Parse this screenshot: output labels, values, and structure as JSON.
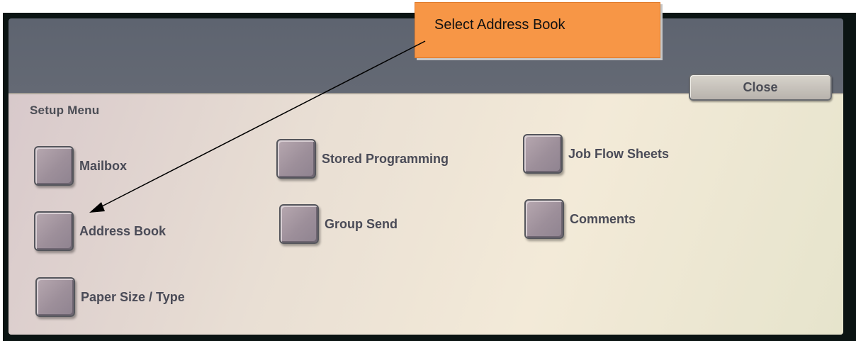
{
  "callout": {
    "text": "Select Address Book"
  },
  "header": {
    "close_label": "Close"
  },
  "setup_menu": {
    "title": "Setup Menu",
    "options": [
      {
        "label": "Mailbox"
      },
      {
        "label": "Stored Programming"
      },
      {
        "label": "Job Flow Sheets"
      },
      {
        "label": "Address Book"
      },
      {
        "label": "Group Send"
      },
      {
        "label": "Comments"
      },
      {
        "label": "Paper Size / Type"
      }
    ]
  },
  "colors": {
    "callout_bg": "#f79646",
    "panel_bg": "#efe6d6",
    "button_face": "#a8999f",
    "text": "#4a4b57"
  }
}
